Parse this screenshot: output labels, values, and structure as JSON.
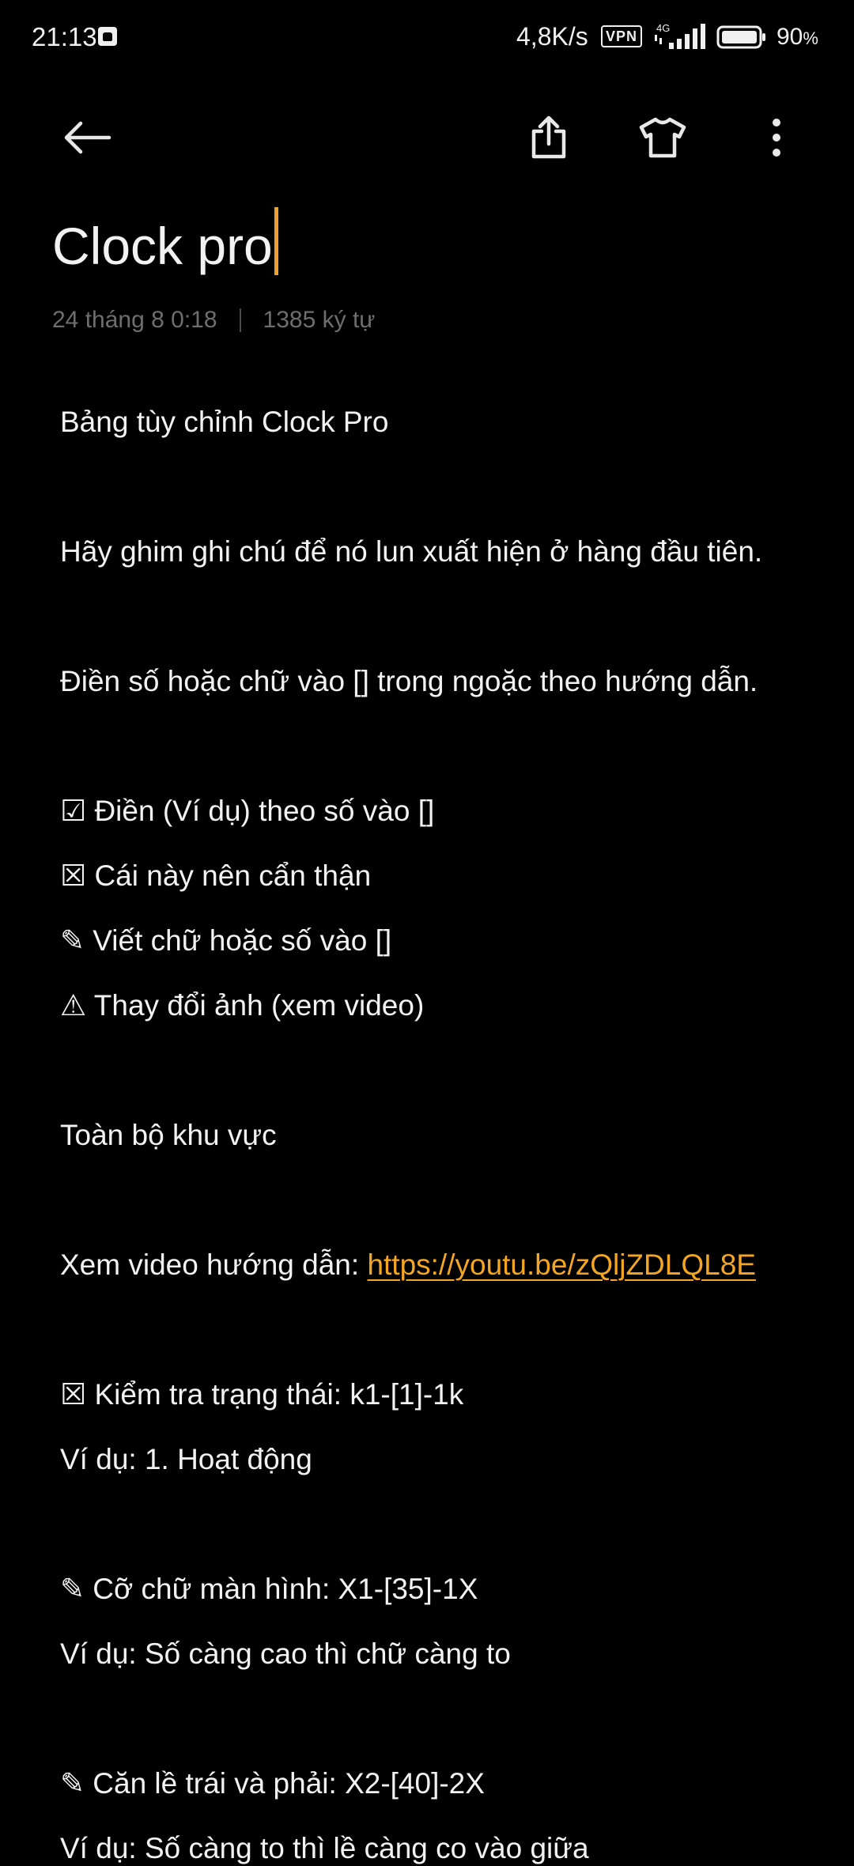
{
  "status_bar": {
    "time": "21:13",
    "app_icon": "android-notification-icon",
    "net_speed": "4,8K/s",
    "vpn": "VPN",
    "network_type": "4G",
    "battery_percent": "90",
    "battery_unit": "%"
  },
  "toolbar": {
    "back_icon": "arrow-left-icon",
    "share_icon": "share-icon",
    "theme_icon": "tshirt-icon",
    "more_icon": "more-vertical-icon"
  },
  "note": {
    "title": "Clock pro",
    "date": "24 tháng 8  0:18",
    "char_count": "1385 ký tự",
    "lines": [
      "Bảng tùy chỉnh Clock Pro",
      "Hãy ghim ghi chú để nó lun xuất hiện ở hàng đầu tiên.",
      "Điền số hoặc chữ vào [] trong ngoặc theo hướng dẫn.",
      "☑ Điền (Ví dụ) theo số vào []",
      "☒ Cái này nên cẩn thận",
      "✎ Viết chữ hoặc số vào []",
      "⚠ Thay đổi ảnh (xem video)",
      "Toàn bộ khu vực",
      "Xem video hướng dẫn: ",
      "☒ Kiểm tra trạng thái: k1-[1]-1k",
      "Ví dụ: 1. Hoạt động",
      "✎ Cỡ chữ màn hình: X1-[35]-1X",
      "Ví dụ: Số càng cao thì chữ càng to",
      "✎ Căn lề trái và phải: X2-[40]-2X",
      "Ví dụ: Số càng to thì lề càng co vào giữa"
    ],
    "video_link": "https://youtu.be/zQljZDLQL8E"
  },
  "colors": {
    "background": "#000000",
    "text": "#f2f2f2",
    "meta": "#6e6e6e",
    "accent": "#f3a623"
  }
}
